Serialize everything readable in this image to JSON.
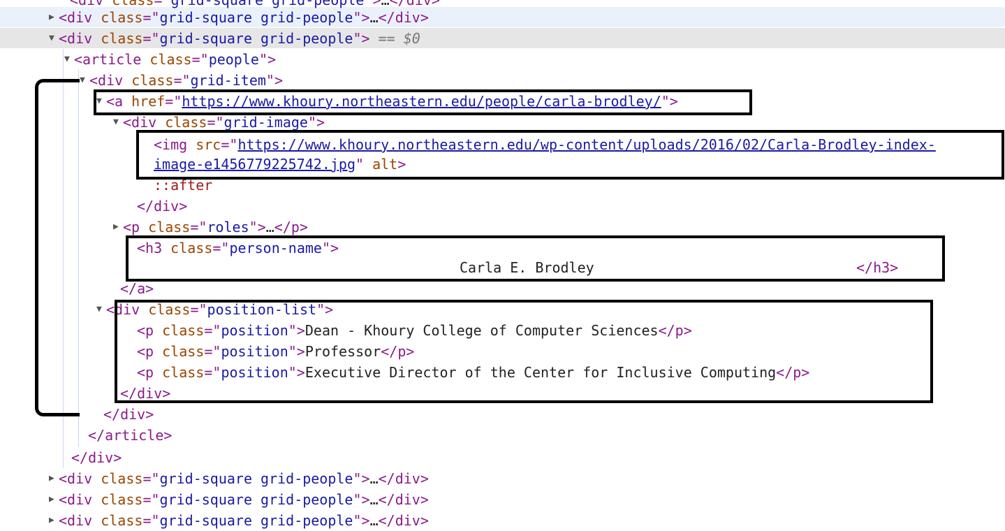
{
  "lines": [
    {
      "id": "l0",
      "t": "",
      "parts": [
        [
          "tag",
          "<div "
        ],
        [
          "attr",
          "class"
        ],
        [
          "tag",
          "=\""
        ],
        [
          "val",
          "grid-square grid-people"
        ],
        [
          "tag",
          "\">"
        ],
        [
          "txt",
          "…"
        ],
        [
          "tag",
          "</div>"
        ]
      ]
    },
    {
      "id": "l1",
      "t": "▶",
      "parts": [
        [
          "tag",
          "<div "
        ],
        [
          "attr",
          "class"
        ],
        [
          "tag",
          "=\""
        ],
        [
          "val",
          "grid-square grid-people"
        ],
        [
          "tag",
          "\">"
        ],
        [
          "txt",
          "…"
        ],
        [
          "tag",
          "</div>"
        ]
      ]
    },
    {
      "id": "l2",
      "t": "▼",
      "parts": [
        [
          "tag",
          "<div "
        ],
        [
          "attr",
          "class"
        ],
        [
          "tag",
          "=\""
        ],
        [
          "val",
          "grid-square grid-people"
        ],
        [
          "tag",
          "\">"
        ],
        [
          "sel0",
          " == $0"
        ]
      ]
    },
    {
      "id": "l3",
      "t": "▼",
      "parts": [
        [
          "tag",
          "<article "
        ],
        [
          "attr",
          "class"
        ],
        [
          "tag",
          "=\""
        ],
        [
          "val",
          "people"
        ],
        [
          "tag",
          "\">"
        ]
      ]
    },
    {
      "id": "l4",
      "t": "▼",
      "parts": [
        [
          "tag",
          "<div "
        ],
        [
          "attr",
          "class"
        ],
        [
          "tag",
          "=\""
        ],
        [
          "val",
          "grid-item"
        ],
        [
          "tag",
          "\">"
        ]
      ]
    },
    {
      "id": "l5",
      "t": "▼",
      "parts": [
        [
          "tag",
          "<a "
        ],
        [
          "attr",
          "href"
        ],
        [
          "tag",
          "=\""
        ],
        [
          "link",
          "https://www.khoury.northeastern.edu/people/carla-brodley/"
        ],
        [
          "tag",
          "\">"
        ]
      ]
    },
    {
      "id": "l6",
      "t": "▼",
      "parts": [
        [
          "tag",
          "<div "
        ],
        [
          "attr",
          "class"
        ],
        [
          "tag",
          "=\""
        ],
        [
          "val",
          "grid-image"
        ],
        [
          "tag",
          "\">"
        ]
      ]
    },
    {
      "id": "l7",
      "t": "",
      "parts": [
        [
          "tag",
          "<img "
        ],
        [
          "attr",
          "src"
        ],
        [
          "tag",
          "=\""
        ],
        [
          "link",
          "https://www.khoury.northeastern.edu/wp-content/uploads/2016/02/Carla-Brodley-index-"
        ]
      ]
    },
    {
      "id": "l8",
      "t": "",
      "parts": [
        [
          "link",
          "image-e1456779225742.jpg"
        ],
        [
          "tag",
          "\" "
        ],
        [
          "attr",
          "alt"
        ],
        [
          "tag",
          ">"
        ]
      ]
    },
    {
      "id": "l9",
      "t": "",
      "parts": [
        [
          "pseudo",
          "::after"
        ]
      ]
    },
    {
      "id": "l10",
      "t": "",
      "parts": [
        [
          "tag",
          "</div>"
        ]
      ]
    },
    {
      "id": "l11",
      "t": "▶",
      "parts": [
        [
          "tag",
          "<p "
        ],
        [
          "attr",
          "class"
        ],
        [
          "tag",
          "=\""
        ],
        [
          "val",
          "roles"
        ],
        [
          "tag",
          "\">"
        ],
        [
          "txt",
          "…"
        ],
        [
          "tag",
          "</p>"
        ]
      ]
    },
    {
      "id": "l12",
      "t": "",
      "parts": [
        [
          "tag",
          "<h3 "
        ],
        [
          "attr",
          "class"
        ],
        [
          "tag",
          "=\""
        ],
        [
          "val",
          "person-name"
        ],
        [
          "tag",
          "\">"
        ]
      ]
    },
    {
      "id": "l13",
      "t": "",
      "parts": [
        [
          "txt",
          "Carla E. Brodley"
        ]
      ]
    },
    {
      "id": "l13b",
      "t": "",
      "parts": [
        [
          "tag",
          "</h3>"
        ]
      ]
    },
    {
      "id": "l14",
      "t": "",
      "parts": [
        [
          "tag",
          "</a>"
        ]
      ]
    },
    {
      "id": "l15",
      "t": "▼",
      "parts": [
        [
          "tag",
          "<div "
        ],
        [
          "attr",
          "class"
        ],
        [
          "tag",
          "=\""
        ],
        [
          "val",
          "position-list"
        ],
        [
          "tag",
          "\">"
        ]
      ]
    },
    {
      "id": "l16",
      "t": "",
      "parts": [
        [
          "tag",
          "<p "
        ],
        [
          "attr",
          "class"
        ],
        [
          "tag",
          "=\""
        ],
        [
          "val",
          "position"
        ],
        [
          "tag",
          "\">"
        ],
        [
          "txt",
          "Dean - Khoury College of Computer Sciences"
        ],
        [
          "tag",
          "</p>"
        ]
      ]
    },
    {
      "id": "l17",
      "t": "",
      "parts": [
        [
          "tag",
          "<p "
        ],
        [
          "attr",
          "class"
        ],
        [
          "tag",
          "=\""
        ],
        [
          "val",
          "position"
        ],
        [
          "tag",
          "\">"
        ],
        [
          "txt",
          "Professor"
        ],
        [
          "tag",
          "</p>"
        ]
      ]
    },
    {
      "id": "l18",
      "t": "",
      "parts": [
        [
          "tag",
          "<p "
        ],
        [
          "attr",
          "class"
        ],
        [
          "tag",
          "=\""
        ],
        [
          "val",
          "position"
        ],
        [
          "tag",
          "\">"
        ],
        [
          "txt",
          "Executive Director of the Center for Inclusive Computing"
        ],
        [
          "tag",
          "</p>"
        ]
      ]
    },
    {
      "id": "l19",
      "t": "",
      "parts": [
        [
          "tag",
          "</div>"
        ]
      ]
    },
    {
      "id": "l20",
      "t": "",
      "parts": [
        [
          "tag",
          "</div>"
        ]
      ]
    },
    {
      "id": "l21",
      "t": "",
      "parts": [
        [
          "tag",
          "</article>"
        ]
      ]
    },
    {
      "id": "l22",
      "t": "",
      "parts": [
        [
          "tag",
          "</div>"
        ]
      ]
    },
    {
      "id": "l23",
      "t": "▶",
      "parts": [
        [
          "tag",
          "<div "
        ],
        [
          "attr",
          "class"
        ],
        [
          "tag",
          "=\""
        ],
        [
          "val",
          "grid-square grid-people"
        ],
        [
          "tag",
          "\">"
        ],
        [
          "txt",
          "…"
        ],
        [
          "tag",
          "</div>"
        ]
      ]
    },
    {
      "id": "l24",
      "t": "▶",
      "parts": [
        [
          "tag",
          "<div "
        ],
        [
          "attr",
          "class"
        ],
        [
          "tag",
          "=\""
        ],
        [
          "val",
          "grid-square grid-people"
        ],
        [
          "tag",
          "\">"
        ],
        [
          "txt",
          "…"
        ],
        [
          "tag",
          "</div>"
        ]
      ]
    },
    {
      "id": "l25",
      "t": "▶",
      "parts": [
        [
          "tag",
          "<div "
        ],
        [
          "attr",
          "class"
        ],
        [
          "tag",
          "=\""
        ],
        [
          "val",
          "grid-square grid-people"
        ],
        [
          "tag",
          "\">"
        ],
        [
          "txt",
          "…"
        ],
        [
          "tag",
          "</div>"
        ]
      ]
    }
  ]
}
